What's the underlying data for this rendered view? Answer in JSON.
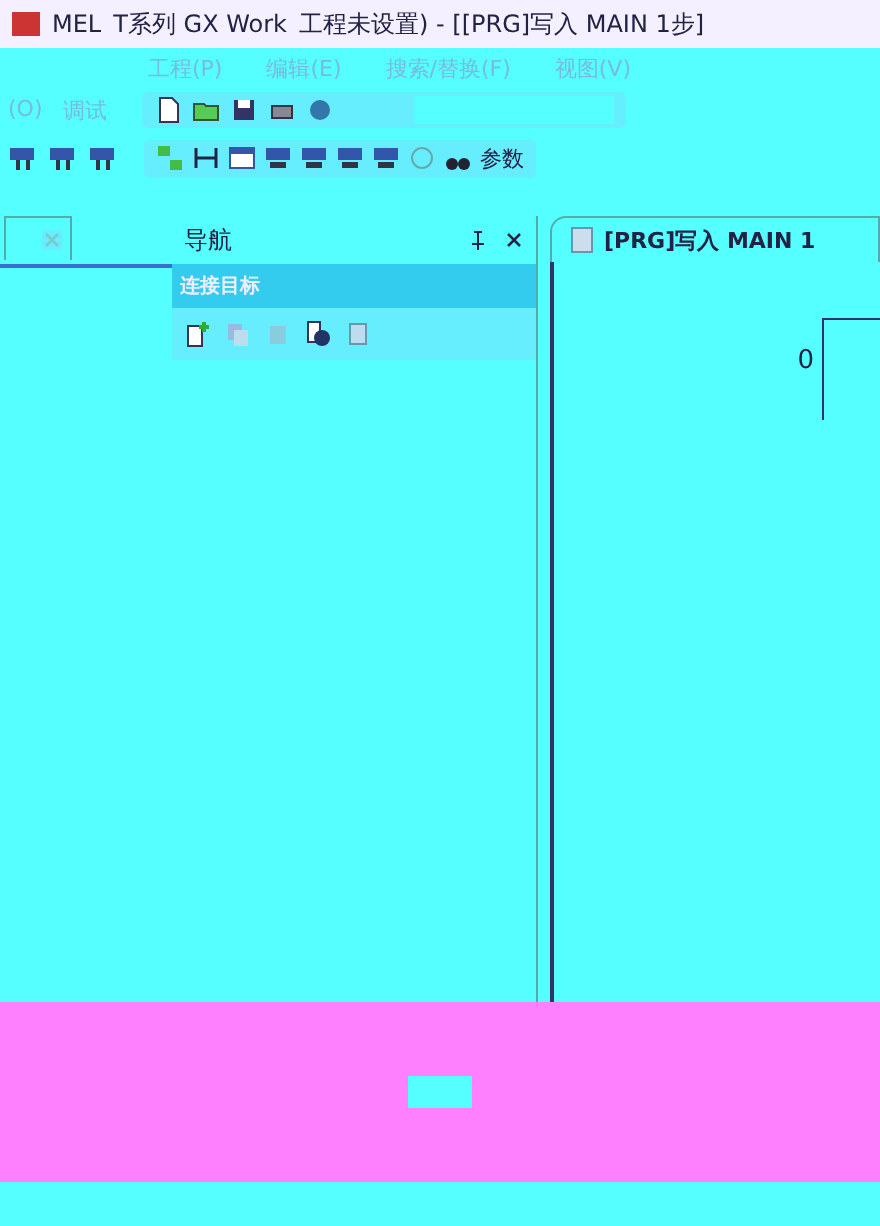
{
  "window": {
    "title_parts": [
      "MEL",
      "T系列 GX Work",
      "工程未设置) - [[PRG]写入 MAIN 1步]"
    ]
  },
  "menu": [
    "工程(P)",
    "编辑(E)",
    "搜索/替换(F)",
    "视图(V)"
  ],
  "menu_row2": [
    "(O)",
    "调试"
  ],
  "toolbar": {
    "label": "参数"
  },
  "navigation": {
    "title": "导航",
    "section": "连接目标"
  },
  "editor": {
    "tab": "[PRG]写入 MAIN 1",
    "step": "0"
  }
}
